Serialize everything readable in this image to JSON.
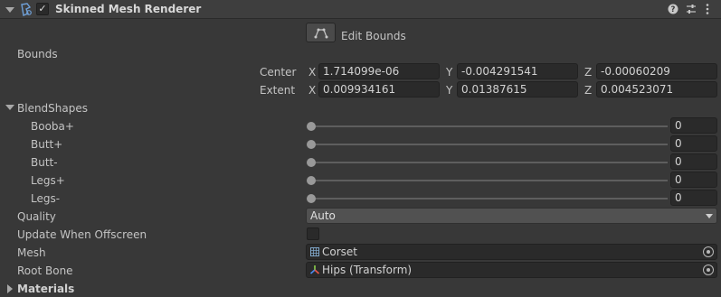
{
  "component": {
    "title": "Skinned Mesh Renderer",
    "enabled": true,
    "icon": "skinned-mesh-renderer-icon",
    "header_icons": [
      "help-icon",
      "settings-sliders-icon",
      "more-vert-icon"
    ]
  },
  "edit_bounds": {
    "label": "Edit Bounds",
    "icon": "bounds-edit-icon"
  },
  "bounds": {
    "label": "Bounds",
    "center": {
      "label": "Center",
      "x_label": "X",
      "y_label": "Y",
      "z_label": "Z",
      "x": "1.714099e-06",
      "y": "-0.004291541",
      "z": "-0.00060209"
    },
    "extent": {
      "label": "Extent",
      "x_label": "X",
      "y_label": "Y",
      "z_label": "Z",
      "x": "0.009934161",
      "y": "0.01387615",
      "z": "0.004523071"
    }
  },
  "blendshapes": {
    "label": "BlendShapes",
    "items": [
      {
        "name": "Booba+",
        "value": "0",
        "fill": 0
      },
      {
        "name": "Butt+",
        "value": "0",
        "fill": 0
      },
      {
        "name": "Butt-",
        "value": "0",
        "fill": 0
      },
      {
        "name": "Legs+",
        "value": "0",
        "fill": 0
      },
      {
        "name": "Legs-",
        "value": "0",
        "fill": 0
      }
    ]
  },
  "quality": {
    "label": "Quality",
    "value": "Auto"
  },
  "update_when_offscreen": {
    "label": "Update When Offscreen",
    "checked": false
  },
  "mesh": {
    "label": "Mesh",
    "value": "Corset",
    "icon": "mesh-grid-icon"
  },
  "root_bone": {
    "label": "Root Bone",
    "value": "Hips (Transform)",
    "icon": "transform-axes-icon"
  },
  "materials": {
    "label": "Materials"
  }
}
